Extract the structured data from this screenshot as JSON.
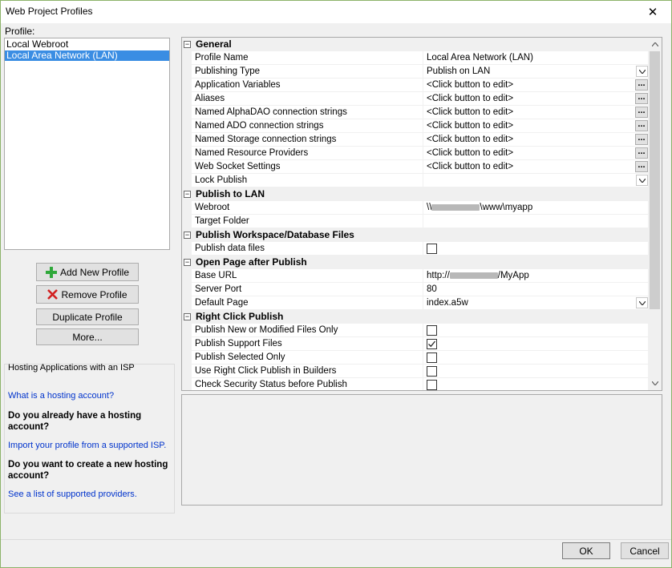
{
  "window": {
    "title": "Web Project Profiles",
    "close_glyph": "✕"
  },
  "profile": {
    "label": "Profile:",
    "items": [
      "Local Webroot",
      "Local Area Network (LAN)"
    ],
    "selected_index": 1
  },
  "buttons": {
    "add": "Add New Profile",
    "remove": "Remove Profile",
    "duplicate": "Duplicate Profile",
    "more": "More...",
    "ok": "OK",
    "cancel": "Cancel"
  },
  "hosting": {
    "title": "Hosting Applications with an ISP",
    "link1": "What is a hosting account?",
    "question1": "Do you already have a hosting account?",
    "link2": "Import your profile from a supported ISP.",
    "question2": "Do you want to create a new hosting account?",
    "link3": "See a list of supported providers."
  },
  "grid": {
    "categories": {
      "general": "General",
      "publish_lan": "Publish to LAN",
      "workspace": "Publish Workspace/Database Files",
      "open_page": "Open Page after Publish",
      "right_click": "Right Click Publish"
    },
    "general_rows": [
      {
        "name": "Profile Name",
        "value": "Local Area Network (LAN)",
        "editor": "none"
      },
      {
        "name": "Publishing Type",
        "value": "Publish on LAN",
        "editor": "dropdown"
      },
      {
        "name": "Application Variables",
        "value": "<Click button to edit>",
        "editor": "ellipsis"
      },
      {
        "name": "Aliases",
        "value": "<Click button to edit>",
        "editor": "ellipsis"
      },
      {
        "name": "Named AlphaDAO connection strings",
        "value": "<Click button to edit>",
        "editor": "ellipsis"
      },
      {
        "name": "Named ADO connection strings",
        "value": "<Click button to edit>",
        "editor": "ellipsis"
      },
      {
        "name": "Named Storage connection strings",
        "value": "<Click button to edit>",
        "editor": "ellipsis"
      },
      {
        "name": "Named Resource Providers",
        "value": "<Click button to edit>",
        "editor": "ellipsis"
      },
      {
        "name": "Web Socket Settings",
        "value": "<Click button to edit>",
        "editor": "ellipsis"
      },
      {
        "name": "Lock Publish",
        "value": "",
        "editor": "dropdown"
      }
    ],
    "lan_rows": {
      "webroot_name": "Webroot",
      "webroot_prefix": "\\\\",
      "webroot_suffix": "\\www\\myapp",
      "target_name": "Target Folder",
      "target_value": ""
    },
    "workspace_rows": {
      "publish_data_name": "Publish data files",
      "publish_data_checked": false
    },
    "open_page_rows": {
      "base_url_name": "Base URL",
      "base_url_prefix": "http://",
      "base_url_suffix": "/MyApp",
      "server_port_name": "Server Port",
      "server_port_value": "80",
      "default_page_name": "Default Page",
      "default_page_value": "index.a5w"
    },
    "right_click_rows": [
      {
        "name": "Publish New or Modified Files Only",
        "checked": false
      },
      {
        "name": "Publish Support Files",
        "checked": true
      },
      {
        "name": "Publish Selected Only",
        "checked": false
      },
      {
        "name": "Use Right Click Publish in Builders",
        "checked": false
      },
      {
        "name": "Check Security Status before Publish",
        "checked": false
      }
    ]
  }
}
